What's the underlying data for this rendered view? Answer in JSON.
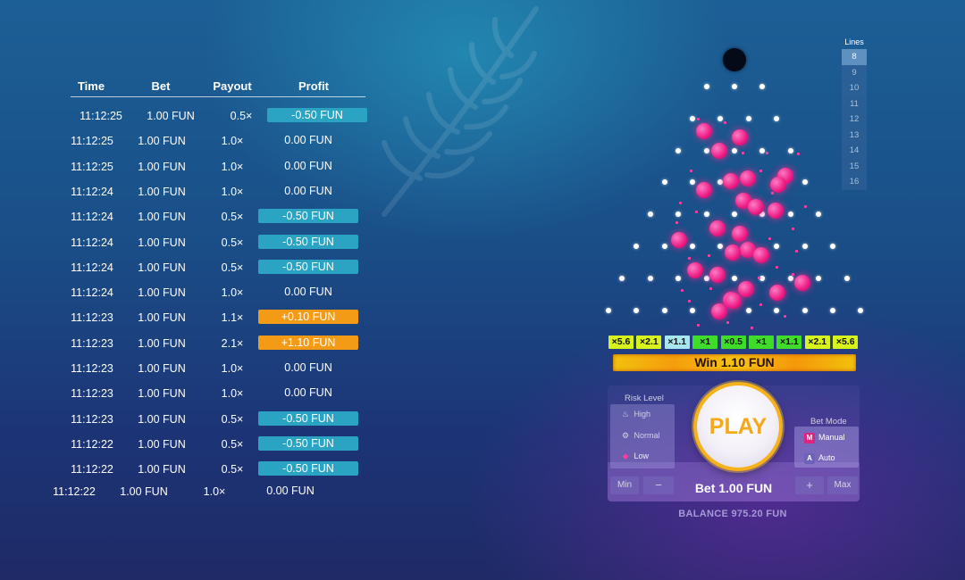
{
  "history": {
    "headers": {
      "time": "Time",
      "bet": "Bet",
      "payout": "Payout",
      "profit": "Profit"
    },
    "rows": [
      {
        "time": "11:12:25",
        "bet": "1.00 FUN",
        "payout": "0.5×",
        "profit": "-0.50 FUN",
        "kind": "neg"
      },
      {
        "time": "11:12:25",
        "bet": "1.00 FUN",
        "payout": "1.0×",
        "profit": "0.00 FUN",
        "kind": "zero"
      },
      {
        "time": "11:12:25",
        "bet": "1.00 FUN",
        "payout": "1.0×",
        "profit": "0.00 FUN",
        "kind": "zero"
      },
      {
        "time": "11:12:24",
        "bet": "1.00 FUN",
        "payout": "1.0×",
        "profit": "0.00 FUN",
        "kind": "zero"
      },
      {
        "time": "11:12:24",
        "bet": "1.00 FUN",
        "payout": "0.5×",
        "profit": "-0.50 FUN",
        "kind": "neg"
      },
      {
        "time": "11:12:24",
        "bet": "1.00 FUN",
        "payout": "0.5×",
        "profit": "-0.50 FUN",
        "kind": "neg"
      },
      {
        "time": "11:12:24",
        "bet": "1.00 FUN",
        "payout": "0.5×",
        "profit": "-0.50 FUN",
        "kind": "neg"
      },
      {
        "time": "11:12:24",
        "bet": "1.00 FUN",
        "payout": "1.0×",
        "profit": "0.00 FUN",
        "kind": "zero"
      },
      {
        "time": "11:12:23",
        "bet": "1.00 FUN",
        "payout": "1.1×",
        "profit": "+0.10 FUN",
        "kind": "pos"
      },
      {
        "time": "11:12:23",
        "bet": "1.00 FUN",
        "payout": "2.1×",
        "profit": "+1.10 FUN",
        "kind": "pos"
      },
      {
        "time": "11:12:23",
        "bet": "1.00 FUN",
        "payout": "1.0×",
        "profit": "0.00 FUN",
        "kind": "zero"
      },
      {
        "time": "11:12:23",
        "bet": "1.00 FUN",
        "payout": "1.0×",
        "profit": "0.00 FUN",
        "kind": "zero"
      },
      {
        "time": "11:12:23",
        "bet": "1.00 FUN",
        "payout": "0.5×",
        "profit": "-0.50 FUN",
        "kind": "neg"
      },
      {
        "time": "11:12:22",
        "bet": "1.00 FUN",
        "payout": "0.5×",
        "profit": "-0.50 FUN",
        "kind": "neg"
      },
      {
        "time": "11:12:22",
        "bet": "1.00 FUN",
        "payout": "0.5×",
        "profit": "-0.50 FUN",
        "kind": "neg"
      },
      {
        "time": "11:12:22",
        "bet": "1.00 FUN",
        "payout": "1.0×",
        "profit": "0.00 FUN",
        "kind": "zero"
      }
    ]
  },
  "lines": {
    "title": "Lines",
    "options": [
      "8",
      "9",
      "10",
      "11",
      "12",
      "13",
      "14",
      "15",
      "16"
    ],
    "selected": "8"
  },
  "multipliers": [
    {
      "label": "×5.6",
      "color": "#d8f21b"
    },
    {
      "label": "×2.1",
      "color": "#d8f21b"
    },
    {
      "label": "×1.1",
      "color": "#a8e6ef"
    },
    {
      "label": "×1",
      "color": "#3fdc2a"
    },
    {
      "label": "×0.5",
      "color": "#3fdc2a"
    },
    {
      "label": "×1",
      "color": "#3fdc2a"
    },
    {
      "label": "×1.1",
      "color": "#3fdc2a"
    },
    {
      "label": "×2.1",
      "color": "#d8f21b"
    },
    {
      "label": "×5.6",
      "color": "#d8f21b"
    }
  ],
  "win": {
    "label": "Win 1.10 FUN"
  },
  "risk": {
    "title": "Risk Level",
    "options": [
      {
        "label": "High",
        "icon": "flame-icon"
      },
      {
        "label": "Normal",
        "icon": "gear-icon"
      },
      {
        "label": "Low",
        "icon": "droplet-icon"
      }
    ],
    "selected": "Low"
  },
  "bet_mode": {
    "title": "Bet Mode",
    "options": [
      {
        "label": "Manual",
        "badge": "M",
        "badge_color": "#e0237f"
      },
      {
        "label": "Auto",
        "badge": "A",
        "badge_color": "#6c63b8"
      }
    ],
    "selected": "Manual"
  },
  "play": {
    "label": "PLAY"
  },
  "bet": {
    "min_label": "Min",
    "minus_label": "−",
    "amount": "Bet 1.00 FUN",
    "plus_label": "+",
    "max_label": "Max"
  },
  "balance": "BALANCE 975.20 FUN",
  "colors": {
    "accent_orange": "#f5a91a",
    "ball_pink": "#ec1b84",
    "profit_negative": "#2ba3c2",
    "profit_positive": "#f39a16"
  }
}
